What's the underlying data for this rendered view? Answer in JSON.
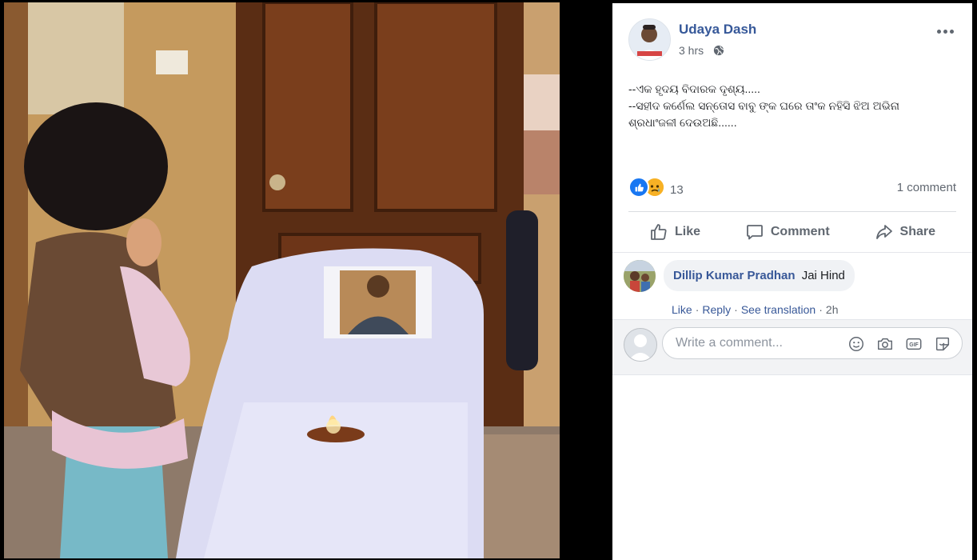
{
  "post": {
    "author": "Udaya Dash",
    "time": "3 hrs",
    "privacy_icon": "globe-icon",
    "text_lines": [
      "--ଏକ ହୃଦୟ ବିଦାରକ ଦୃଶ୍ୟ.....",
      "--ସହୀଦ କର୍ଣେଲ ସନ୍ତୋସ ବାବୁ ଙ୍କ ଘରେ ତାଂକ ନହିସି ଝିଅ ଅଭିନା ଶ୍ରଧାଂଜଳୀ ଦେଉଅଛି......"
    ],
    "reaction_count": "13",
    "comment_count": "1 comment"
  },
  "actions": {
    "like": "Like",
    "comment": "Comment",
    "share": "Share"
  },
  "comments": [
    {
      "name": "Dillip Kumar Pradhan",
      "text": "Jai Hind",
      "like": "Like",
      "reply": "Reply",
      "translate": "See translation",
      "time": "2h"
    }
  ],
  "composer": {
    "placeholder": "Write a comment..."
  },
  "colors": {
    "link": "#365899",
    "like_blue": "#1877f2",
    "sad_yellow": "#f7b125"
  }
}
